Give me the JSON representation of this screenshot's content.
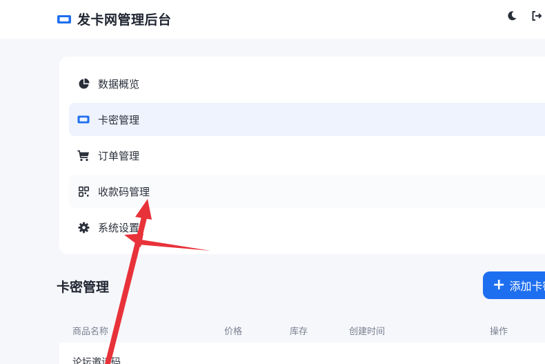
{
  "header": {
    "title": "发卡网管理后台",
    "icons": {
      "brand": "ticket-icon",
      "theme": "moon-icon",
      "logout": "logout-icon"
    }
  },
  "menu": {
    "items": [
      {
        "label": "数据概览",
        "icon": "pie-chart-icon"
      },
      {
        "label": "卡密管理",
        "icon": "ticket-icon",
        "active": true
      },
      {
        "label": "订单管理",
        "icon": "shopping-cart-icon"
      },
      {
        "label": "收款码管理",
        "icon": "qrcode-icon"
      },
      {
        "label": "系统设置",
        "icon": "gear-icon"
      }
    ]
  },
  "main": {
    "section_title": "卡密管理",
    "add_button": "添加卡密",
    "table": {
      "headers": [
        "商品名称",
        "价格",
        "库存",
        "创建时间",
        "操作"
      ],
      "rows": [
        [
          "论坛邀请码"
        ]
      ]
    }
  },
  "colors": {
    "accent": "#1e6ff0",
    "active_bg": "#eef3fd",
    "annotation_arrow": "#e8323a"
  }
}
